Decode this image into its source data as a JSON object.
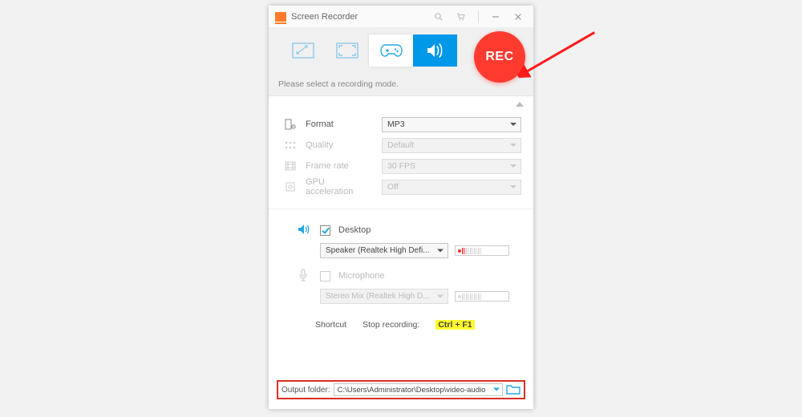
{
  "titlebar": {
    "title": "Screen Recorder"
  },
  "rec_label": "REC",
  "hint": "Please select a recording mode.",
  "settings": {
    "format": {
      "label": "Format",
      "value": "MP3"
    },
    "quality": {
      "label": "Quality",
      "value": "Default"
    },
    "framerate": {
      "label": "Frame rate",
      "value": "30 FPS"
    },
    "gpu": {
      "label": "GPU acceleration",
      "value": "Off"
    }
  },
  "audio": {
    "desktop": {
      "label": "Desktop",
      "checked": true,
      "device": "Speaker (Realtek High Defi..."
    },
    "microphone": {
      "label": "Microphone",
      "checked": false,
      "device": "Stereo Mix (Realtek High D..."
    }
  },
  "shortcut": {
    "label": "Shortcut",
    "stop_label": "Stop recording:",
    "stop_key": "Ctrl + F1"
  },
  "output": {
    "label": "Output folder:",
    "path": "C:\\Users\\Administrator\\Desktop\\video-audio"
  },
  "colors": {
    "accent": "#27a8e0",
    "rec": "#ff3b30",
    "highlight_border": "#d93025"
  }
}
